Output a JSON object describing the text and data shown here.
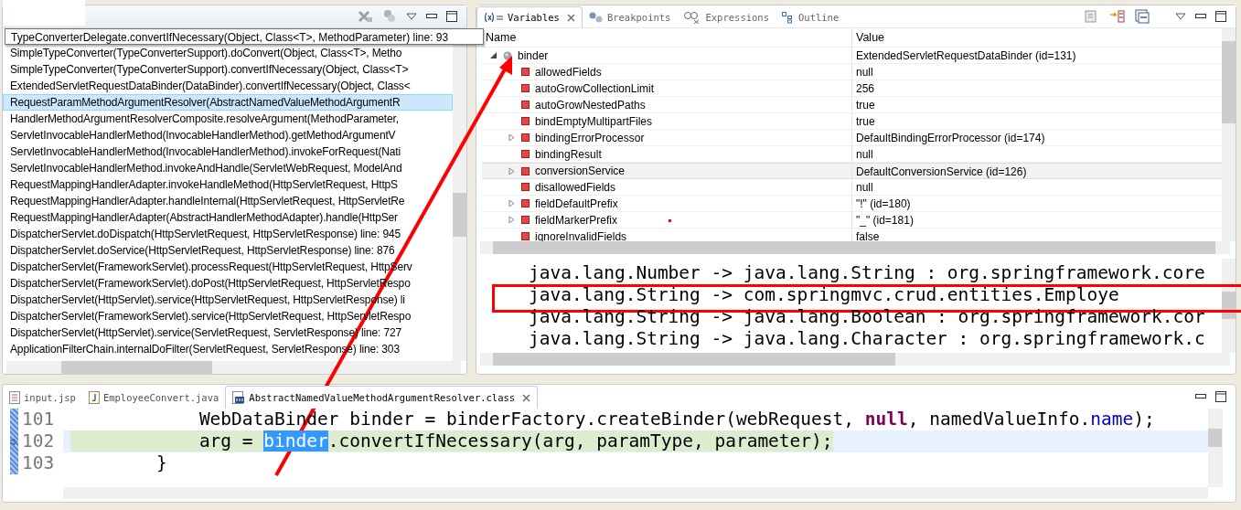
{
  "stack_panel": {
    "tooltip": "TypeConverterDelegate.convertIfNecessary(Object, Class<T>, MethodParameter) line: 93",
    "frames": [
      {
        "text": "SimpleTypeConverter(TypeConverterSupport).doConvert(Object, Class<T>, Metho",
        "selected": false
      },
      {
        "text": "SimpleTypeConverter(TypeConverterSupport).convertIfNecessary(Object, Class<T>",
        "selected": false
      },
      {
        "text": "ExtendedServletRequestDataBinder(DataBinder).convertIfNecessary(Object, Class<",
        "selected": false
      },
      {
        "text": "RequestParamMethodArgumentResolver(AbstractNamedValueMethodArgumentR",
        "selected": true
      },
      {
        "text": "HandlerMethodArgumentResolverComposite.resolveArgument(MethodParameter,",
        "selected": false
      },
      {
        "text": "ServletInvocableHandlerMethod(InvocableHandlerMethod).getMethodArgumentV",
        "selected": false
      },
      {
        "text": "ServletInvocableHandlerMethod(InvocableHandlerMethod).invokeForRequest(Nati",
        "selected": false
      },
      {
        "text": "ServletInvocableHandlerMethod.invokeAndHandle(ServletWebRequest, ModelAnd",
        "selected": false
      },
      {
        "text": "RequestMappingHandlerAdapter.invokeHandleMethod(HttpServletRequest, HttpS",
        "selected": false
      },
      {
        "text": "RequestMappingHandlerAdapter.handleInternal(HttpServletRequest, HttpServletRe",
        "selected": false
      },
      {
        "text": "RequestMappingHandlerAdapter(AbstractHandlerMethodAdapter).handle(HttpSer",
        "selected": false
      },
      {
        "text": "DispatcherServlet.doDispatch(HttpServletRequest, HttpServletResponse) line: 945",
        "selected": false
      },
      {
        "text": "DispatcherServlet.doService(HttpServletRequest, HttpServletResponse) line: 876",
        "selected": false
      },
      {
        "text": "DispatcherServlet(FrameworkServlet).processRequest(HttpServletRequest, HttpServ",
        "selected": false
      },
      {
        "text": "DispatcherServlet(FrameworkServlet).doPost(HttpServletRequest, HttpServletRespo",
        "selected": false
      },
      {
        "text": "DispatcherServlet(HttpServlet).service(HttpServletRequest, HttpServletResponse) li",
        "selected": false
      },
      {
        "text": "DispatcherServlet(FrameworkServlet).service(HttpServletRequest, HttpServletRespo",
        "selected": false
      },
      {
        "text": "DispatcherServlet(HttpServlet).service(ServletRequest, ServletResponse) line: 727",
        "selected": false
      },
      {
        "text": "ApplicationFilterChain.internalDoFilter(ServletRequest, ServletResponse) line: 303",
        "selected": false
      }
    ]
  },
  "variables_panel": {
    "tabs": [
      {
        "label": "Variables",
        "kind": "variables",
        "selected": true
      },
      {
        "label": "Breakpoints",
        "kind": "breakpoints",
        "selected": false
      },
      {
        "label": "Expressions",
        "kind": "expressions",
        "selected": false
      },
      {
        "label": "Outline",
        "kind": "outline",
        "selected": false
      }
    ],
    "columns": [
      "Name",
      "Value"
    ],
    "variables": [
      {
        "name": "binder",
        "value": "ExtendedServletRequestDataBinder  (id=131)",
        "kind": "local",
        "expanded": true,
        "selected": false,
        "children": [
          {
            "name": "allowedFields",
            "value": "null",
            "kind": "field",
            "expandable": false,
            "selected": false
          },
          {
            "name": "autoGrowCollectionLimit",
            "value": "256",
            "kind": "field",
            "expandable": false,
            "selected": false
          },
          {
            "name": "autoGrowNestedPaths",
            "value": "true",
            "kind": "field",
            "expandable": false,
            "selected": false
          },
          {
            "name": "bindEmptyMultipartFiles",
            "value": "true",
            "kind": "field",
            "expandable": false,
            "selected": false
          },
          {
            "name": "bindingErrorProcessor",
            "value": "DefaultBindingErrorProcessor  (id=174)",
            "kind": "field",
            "expandable": true,
            "selected": false
          },
          {
            "name": "bindingResult",
            "value": "null",
            "kind": "field",
            "expandable": false,
            "selected": false
          },
          {
            "name": "conversionService",
            "value": "DefaultConversionService  (id=126)",
            "kind": "field",
            "expandable": true,
            "selected": true
          },
          {
            "name": "disallowedFields",
            "value": "null",
            "kind": "field",
            "expandable": false,
            "selected": false
          },
          {
            "name": "fieldDefaultPrefix",
            "value": "\"!\" (id=180)",
            "kind": "field",
            "expandable": true,
            "selected": false
          },
          {
            "name": "fieldMarkerPrefix",
            "value": "\"_\" (id=181)",
            "kind": "field",
            "expandable": true,
            "selected": false
          },
          {
            "name": "ignoreInvalidFields",
            "value": "false",
            "kind": "field",
            "expandable": false,
            "selected": false
          }
        ]
      }
    ],
    "detail_lines": [
      {
        "text": "java.lang.Number -> java.lang.String : org.springframework.core",
        "framed": false
      },
      {
        "text": "java.lang.String -> com.springmvc.crud.entities.Employe",
        "framed": true
      },
      {
        "text": "java.lang.String -> java.lang.Boolean : org.springframework.cor",
        "framed": false
      },
      {
        "text": "java.lang.String -> java.lang.Character : org.springframework.c",
        "framed": false
      }
    ]
  },
  "editor": {
    "tabs": [
      {
        "label": "input.jsp",
        "kind": "jsp",
        "selected": false,
        "closable": false
      },
      {
        "label": "EmployeeConvert.java",
        "kind": "java",
        "selected": false,
        "closable": false
      },
      {
        "label": "AbstractNamedValueMethodArgumentResolver.class",
        "kind": "class",
        "selected": true,
        "closable": true
      }
    ],
    "lines": [
      {
        "number": "101",
        "current": false,
        "tokens": [
          {
            "text": "            WebDataBinder binder = binderFactory.createBinder(webRequest, ",
            "kind": "plain"
          },
          {
            "text": "null",
            "kind": "keyword"
          },
          {
            "text": ", namedValueInfo.",
            "kind": "plain"
          },
          {
            "text": "name",
            "kind": "field"
          },
          {
            "text": ");",
            "kind": "plain"
          }
        ]
      },
      {
        "number": "102",
        "current": true,
        "tokens": [
          {
            "text": "            arg = ",
            "kind": "plain"
          },
          {
            "text": "binder",
            "kind": "selection"
          },
          {
            "text": ".convertIfNecessary(arg, paramType, parameter);",
            "kind": "plain"
          }
        ]
      },
      {
        "number": "103",
        "current": false,
        "tokens": [
          {
            "text": "        }",
            "kind": "plain"
          }
        ]
      }
    ]
  }
}
